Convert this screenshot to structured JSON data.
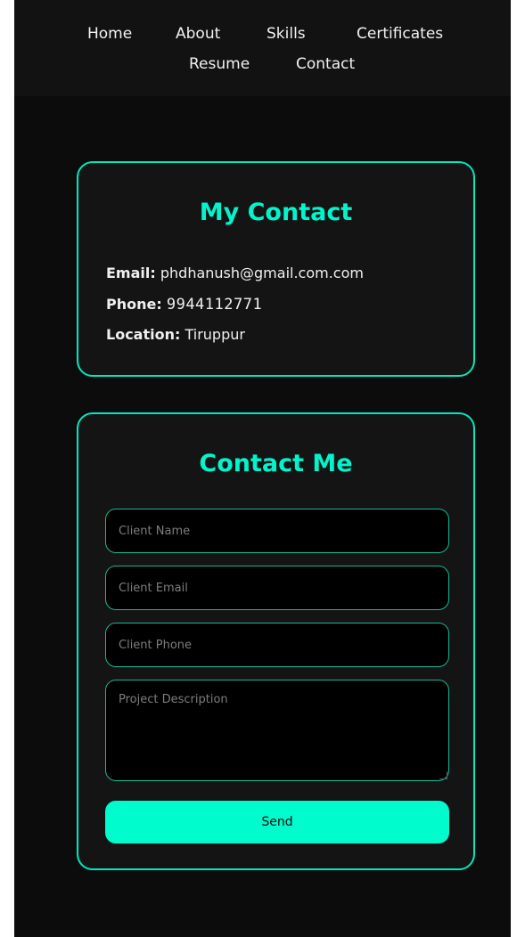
{
  "nav": {
    "links": [
      "Home",
      "About",
      "Skills",
      "Certificates",
      "Resume",
      "Contact"
    ]
  },
  "my_contact": {
    "title": "My Contact",
    "email_label": "Email:",
    "email_value": "phdhanush@gmail.com.com",
    "phone_label": "Phone:",
    "phone_value": "9944112771",
    "location_label": "Location:",
    "location_value": "Tiruppur"
  },
  "contact_form": {
    "title": "Contact Me",
    "name_placeholder": "Client Name",
    "email_placeholder": "Client Email",
    "phone_placeholder": "Client Phone",
    "description_placeholder": "Project Description",
    "send_label": "Send"
  },
  "colors": {
    "accent": "#00f5cc",
    "page_background": "#0c0c0c",
    "card_background": "#141414",
    "button": "#00fbcd"
  }
}
